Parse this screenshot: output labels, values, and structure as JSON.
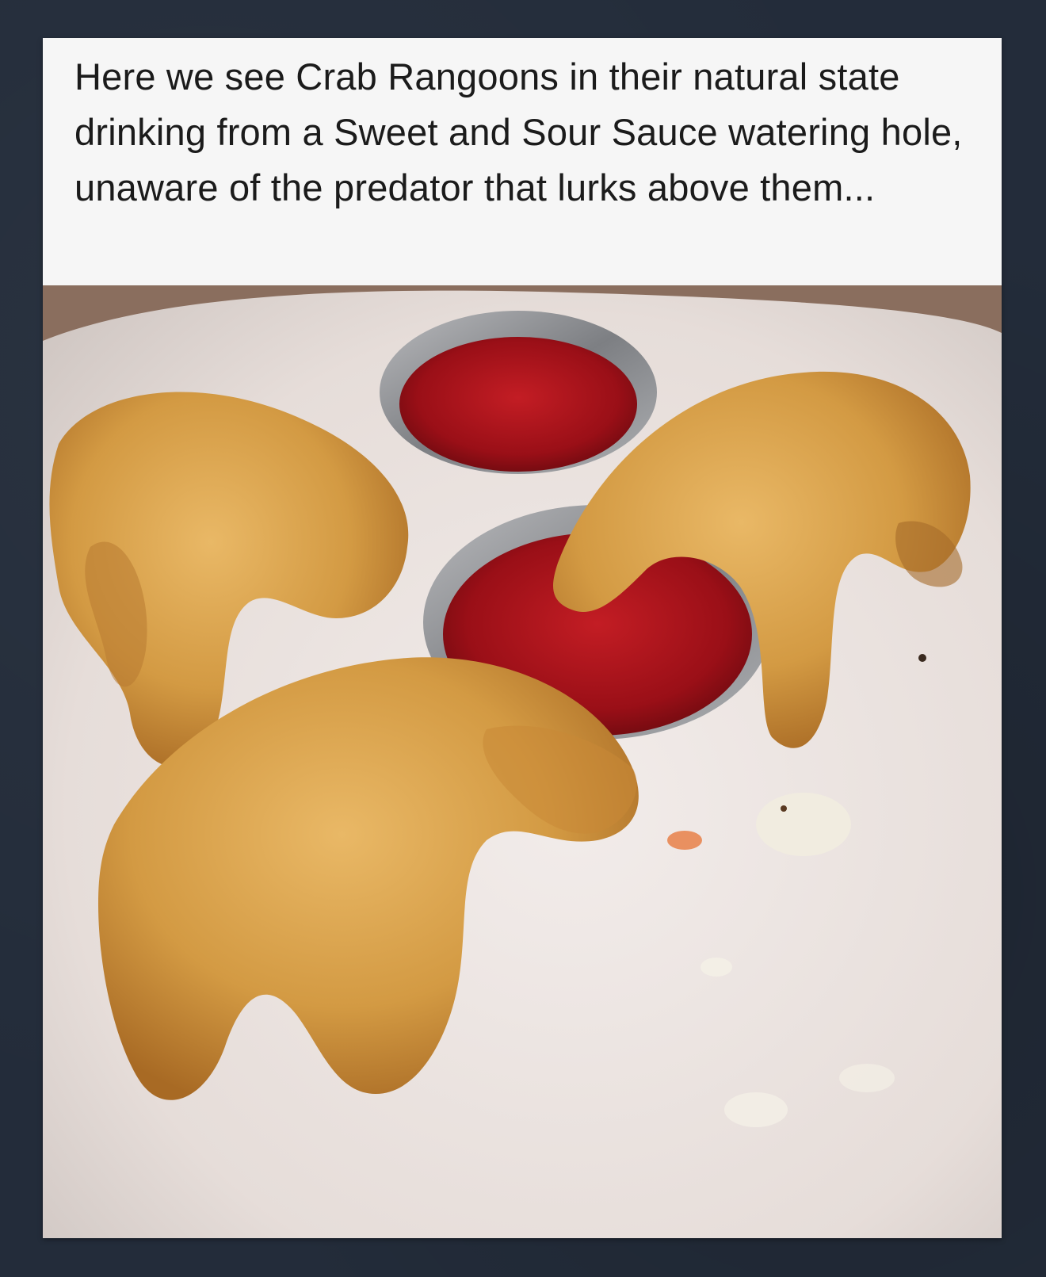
{
  "post": {
    "caption": "Here we see Crab Rangoons in their natural state drinking from a Sweet and Sour Sauce watering hole, unaware of the predator that lurks above them..."
  },
  "photo": {
    "subject_icon": "food-photo-icon",
    "colors": {
      "plate": "#e9e2df",
      "wrapper": "#d79a3f",
      "sauce": "#a3121a",
      "cup": "#8c8d90"
    }
  }
}
